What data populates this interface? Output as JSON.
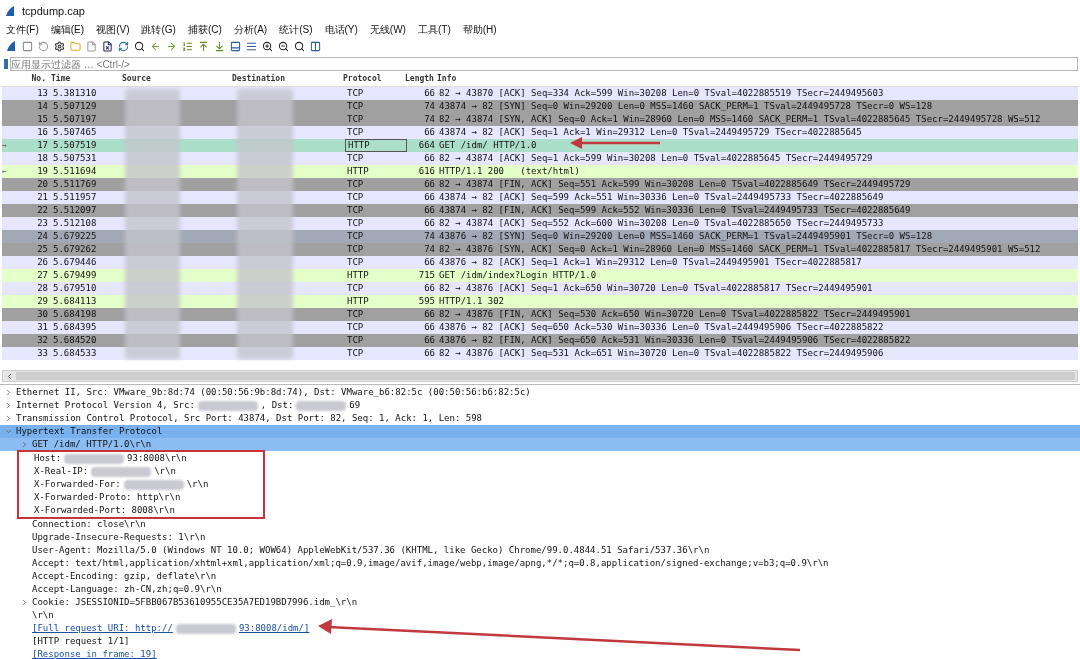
{
  "window": {
    "title": "tcpdump.cap"
  },
  "menu": [
    "文件(F)",
    "编辑(E)",
    "视图(V)",
    "跳转(G)",
    "捕获(C)",
    "分析(A)",
    "统计(S)",
    "电话(Y)",
    "无线(W)",
    "工具(T)",
    "帮助(H)"
  ],
  "filter": {
    "placeholder": "应用显示过滤器 … <Ctrl-/>"
  },
  "packet_list": {
    "columns": [
      "No.",
      "Time",
      "Source",
      "Destination",
      "Protocol",
      "Length",
      "Info"
    ],
    "rows": [
      {
        "no": "13",
        "time": "5.381310",
        "protocol": "TCP",
        "length": "66",
        "info": "82 → 43870 [ACK] Seq=334 Ack=599 Win=30208 Len=0 TSval=4022885519 TSecr=2449495603",
        "color": "#e7e6ff",
        "selected": false
      },
      {
        "no": "14",
        "time": "5.507129",
        "protocol": "TCP",
        "length": "74",
        "info": "43874 → 82 [SYN] Seq=0 Win=29200 Len=0 MSS=1460 SACK_PERM=1 TSval=2449495728 TSecr=0 WS=128",
        "color": "#a0a0a0",
        "selected": false
      },
      {
        "no": "15",
        "time": "5.507197",
        "protocol": "TCP",
        "length": "74",
        "info": "82 → 43874 [SYN, ACK] Seq=0 Ack=1 Win=28960 Len=0 MSS=1460 SACK_PERM=1 TSval=4022885645 TSecr=2449495728 WS=512",
        "color": "#a0a0a0",
        "selected": false
      },
      {
        "no": "16",
        "time": "5.507465",
        "protocol": "TCP",
        "length": "66",
        "info": "43874 → 82 [ACK] Seq=1 Ack=1 Win=29312 Len=0 TSval=2449495729 TSecr=4022885645",
        "color": "#e7e6ff",
        "selected": false
      },
      {
        "no": "17",
        "time": "5.507519",
        "protocol": "HTTP",
        "length": "664",
        "info": "GET /idm/ HTTP/1.0",
        "color": "#acdfc9",
        "selected": true,
        "marker": "→"
      },
      {
        "no": "18",
        "time": "5.507531",
        "protocol": "TCP",
        "length": "66",
        "info": "82 → 43874 [ACK] Seq=1 Ack=599 Win=30208 Len=0 TSval=4022885645 TSecr=2449495729",
        "color": "#e7e6ff",
        "selected": false
      },
      {
        "no": "19",
        "time": "5.511694",
        "protocol": "HTTP",
        "length": "616",
        "info": "HTTP/1.1 200   (text/html)",
        "color": "#e4ffc7",
        "selected": false,
        "marker": "←"
      },
      {
        "no": "20",
        "time": "5.511769",
        "protocol": "TCP",
        "length": "66",
        "info": "82 → 43874 [FIN, ACK] Seq=551 Ack=599 Win=30208 Len=0 TSval=4022885649 TSecr=2449495729",
        "color": "#a0a0a0",
        "selected": false
      },
      {
        "no": "21",
        "time": "5.511957",
        "protocol": "TCP",
        "length": "66",
        "info": "43874 → 82 [ACK] Seq=599 Ack=551 Win=30336 Len=0 TSval=2449495733 TSecr=4022885649",
        "color": "#e7e6ff",
        "selected": false
      },
      {
        "no": "22",
        "time": "5.512097",
        "protocol": "TCP",
        "length": "66",
        "info": "43874 → 82 [FIN, ACK] Seq=599 Ack=552 Win=30336 Len=0 TSval=2449495733 TSecr=4022885649",
        "color": "#a0a0a0",
        "selected": false
      },
      {
        "no": "23",
        "time": "5.512108",
        "protocol": "TCP",
        "length": "66",
        "info": "82 → 43874 [ACK] Seq=552 Ack=600 Win=30208 Len=0 TSval=4022885650 TSecr=2449495733",
        "color": "#e7e6ff",
        "selected": false
      },
      {
        "no": "24",
        "time": "5.679225",
        "protocol": "TCP",
        "length": "74",
        "info": "43876 → 82 [SYN] Seq=0 Win=29200 Len=0 MSS=1460 SACK_PERM=1 TSval=2449495901 TSecr=0 WS=128",
        "color": "#a2a9b6",
        "selected": false
      },
      {
        "no": "25",
        "time": "5.679262",
        "protocol": "TCP",
        "length": "74",
        "info": "82 → 43876 [SYN, ACK] Seq=0 Ack=1 Win=28960 Len=0 MSS=1460 SACK_PERM=1 TSval=4022885817 TSecr=2449495901 WS=512",
        "color": "#a0a0a0",
        "selected": false
      },
      {
        "no": "26",
        "time": "5.679446",
        "protocol": "TCP",
        "length": "66",
        "info": "43876 → 82 [ACK] Seq=1 Ack=1 Win=29312 Len=0 TSval=2449495901 TSecr=4022885817",
        "color": "#e7e6ff",
        "selected": false
      },
      {
        "no": "27",
        "time": "5.679499",
        "protocol": "HTTP",
        "length": "715",
        "info": "GET /idm/index?Login HTTP/1.0",
        "color": "#e4ffc7",
        "selected": false
      },
      {
        "no": "28",
        "time": "5.679510",
        "protocol": "TCP",
        "length": "66",
        "info": "82 → 43876 [ACK] Seq=1 Ack=650 Win=30720 Len=0 TSval=4022885817 TSecr=2449495901",
        "color": "#e7e6ff",
        "selected": false
      },
      {
        "no": "29",
        "time": "5.684113",
        "protocol": "HTTP",
        "length": "595",
        "info": "HTTP/1.1 302",
        "color": "#e4ffc7",
        "selected": false
      },
      {
        "no": "30",
        "time": "5.684198",
        "protocol": "TCP",
        "length": "66",
        "info": "82 → 43876 [FIN, ACK] Seq=530 Ack=650 Win=30720 Len=0 TSval=4022885822 TSecr=2449495901",
        "color": "#a0a0a0",
        "selected": false
      },
      {
        "no": "31",
        "time": "5.684395",
        "protocol": "TCP",
        "length": "66",
        "info": "43876 → 82 [ACK] Seq=650 Ack=530 Win=30336 Len=0 TSval=2449495906 TSecr=4022885822",
        "color": "#e7e6ff",
        "selected": false
      },
      {
        "no": "32",
        "time": "5.684520",
        "protocol": "TCP",
        "length": "66",
        "info": "43876 → 82 [FIN, ACK] Seq=650 Ack=531 Win=30336 Len=0 TSval=2449495906 TSecr=4022885822",
        "color": "#a0a0a0",
        "selected": false
      },
      {
        "no": "33",
        "time": "5.684533",
        "protocol": "TCP",
        "length": "66",
        "info": "82 → 43876 [ACK] Seq=531 Ack=651 Win=30720 Len=0 TSval=4022885822 TSecr=2449495906",
        "color": "#e7e6ff",
        "selected": false
      }
    ]
  },
  "details": [
    {
      "segments": [
        "Ethernet II, Src: VMware_9b:8d:74 (00:50:56:9b:8d:74), Dst: VMware_b6:82:5c (00:50:56:b6:82:5c)"
      ],
      "expanded": false,
      "selected": false
    },
    {
      "segments": [
        "Internet Protocol Version 4, Src:",
        ", Dst:",
        "69"
      ],
      "expanded": false,
      "selected": false
    },
    {
      "segments": [
        "Transmission Control Protocol, Src Port: 43874, Dst Port: 82, Seq: 1, Ack: 1, Len: 598"
      ],
      "expanded": false,
      "selected": false
    },
    {
      "segments": [
        "Hypertext Transfer Protocol"
      ],
      "expanded": true,
      "selected": true,
      "children": [
        {
          "segments": [
            "GET /idm/ HTTP/1.0\\r\\n"
          ],
          "expanded": false,
          "selected": true
        },
        {
          "segments": [
            "Host:",
            "93:8008\\r\\n"
          ],
          "boxed": true
        },
        {
          "segments": [
            "X-Real-IP:",
            "\\r\\n"
          ],
          "boxed": true
        },
        {
          "segments": [
            "X-Forwarded-For:",
            "\\r\\n"
          ],
          "boxed": true
        },
        {
          "segments": [
            "X-Forwarded-Proto: http\\r\\n"
          ],
          "boxed": true
        },
        {
          "segments": [
            "X-Forwarded-Port: 8008\\r\\n"
          ],
          "boxed": true
        },
        {
          "segments": [
            "Connection: close\\r\\n"
          ]
        },
        {
          "segments": [
            "Upgrade-Insecure-Requests: 1\\r\\n"
          ]
        },
        {
          "segments": [
            "User-Agent: Mozilla/5.0 (Windows NT 10.0; WOW64) AppleWebKit/537.36 (KHTML, like Gecko) Chrome/99.0.4844.51 Safari/537.36\\r\\n"
          ]
        },
        {
          "segments": [
            "Accept: text/html,application/xhtml+xml,application/xml;q=0.9,image/avif,image/webp,image/apng,*/*;q=0.8,application/signed-exchange;v=b3;q=0.9\\r\\n"
          ]
        },
        {
          "segments": [
            "Accept-Encoding: gzip, deflate\\r\\n"
          ]
        },
        {
          "segments": [
            "Accept-Language: zh-CN,zh;q=0.9\\r\\n"
          ]
        },
        {
          "segments": [
            "Cookie: JSESSIONID=5FBB067B53610955CE35A7ED19BD7996.idm_\\r\\n"
          ],
          "expanded": false
        },
        {
          "segments": [
            "\\r\\n"
          ]
        },
        {
          "segments": [
            "[Full request URI: http://",
            "93:8008/idm/]"
          ],
          "link": true
        },
        {
          "segments": [
            "[HTTP request 1/1]"
          ]
        },
        {
          "segments": [
            "[Response in frame: 19]"
          ],
          "link": true
        }
      ]
    }
  ]
}
